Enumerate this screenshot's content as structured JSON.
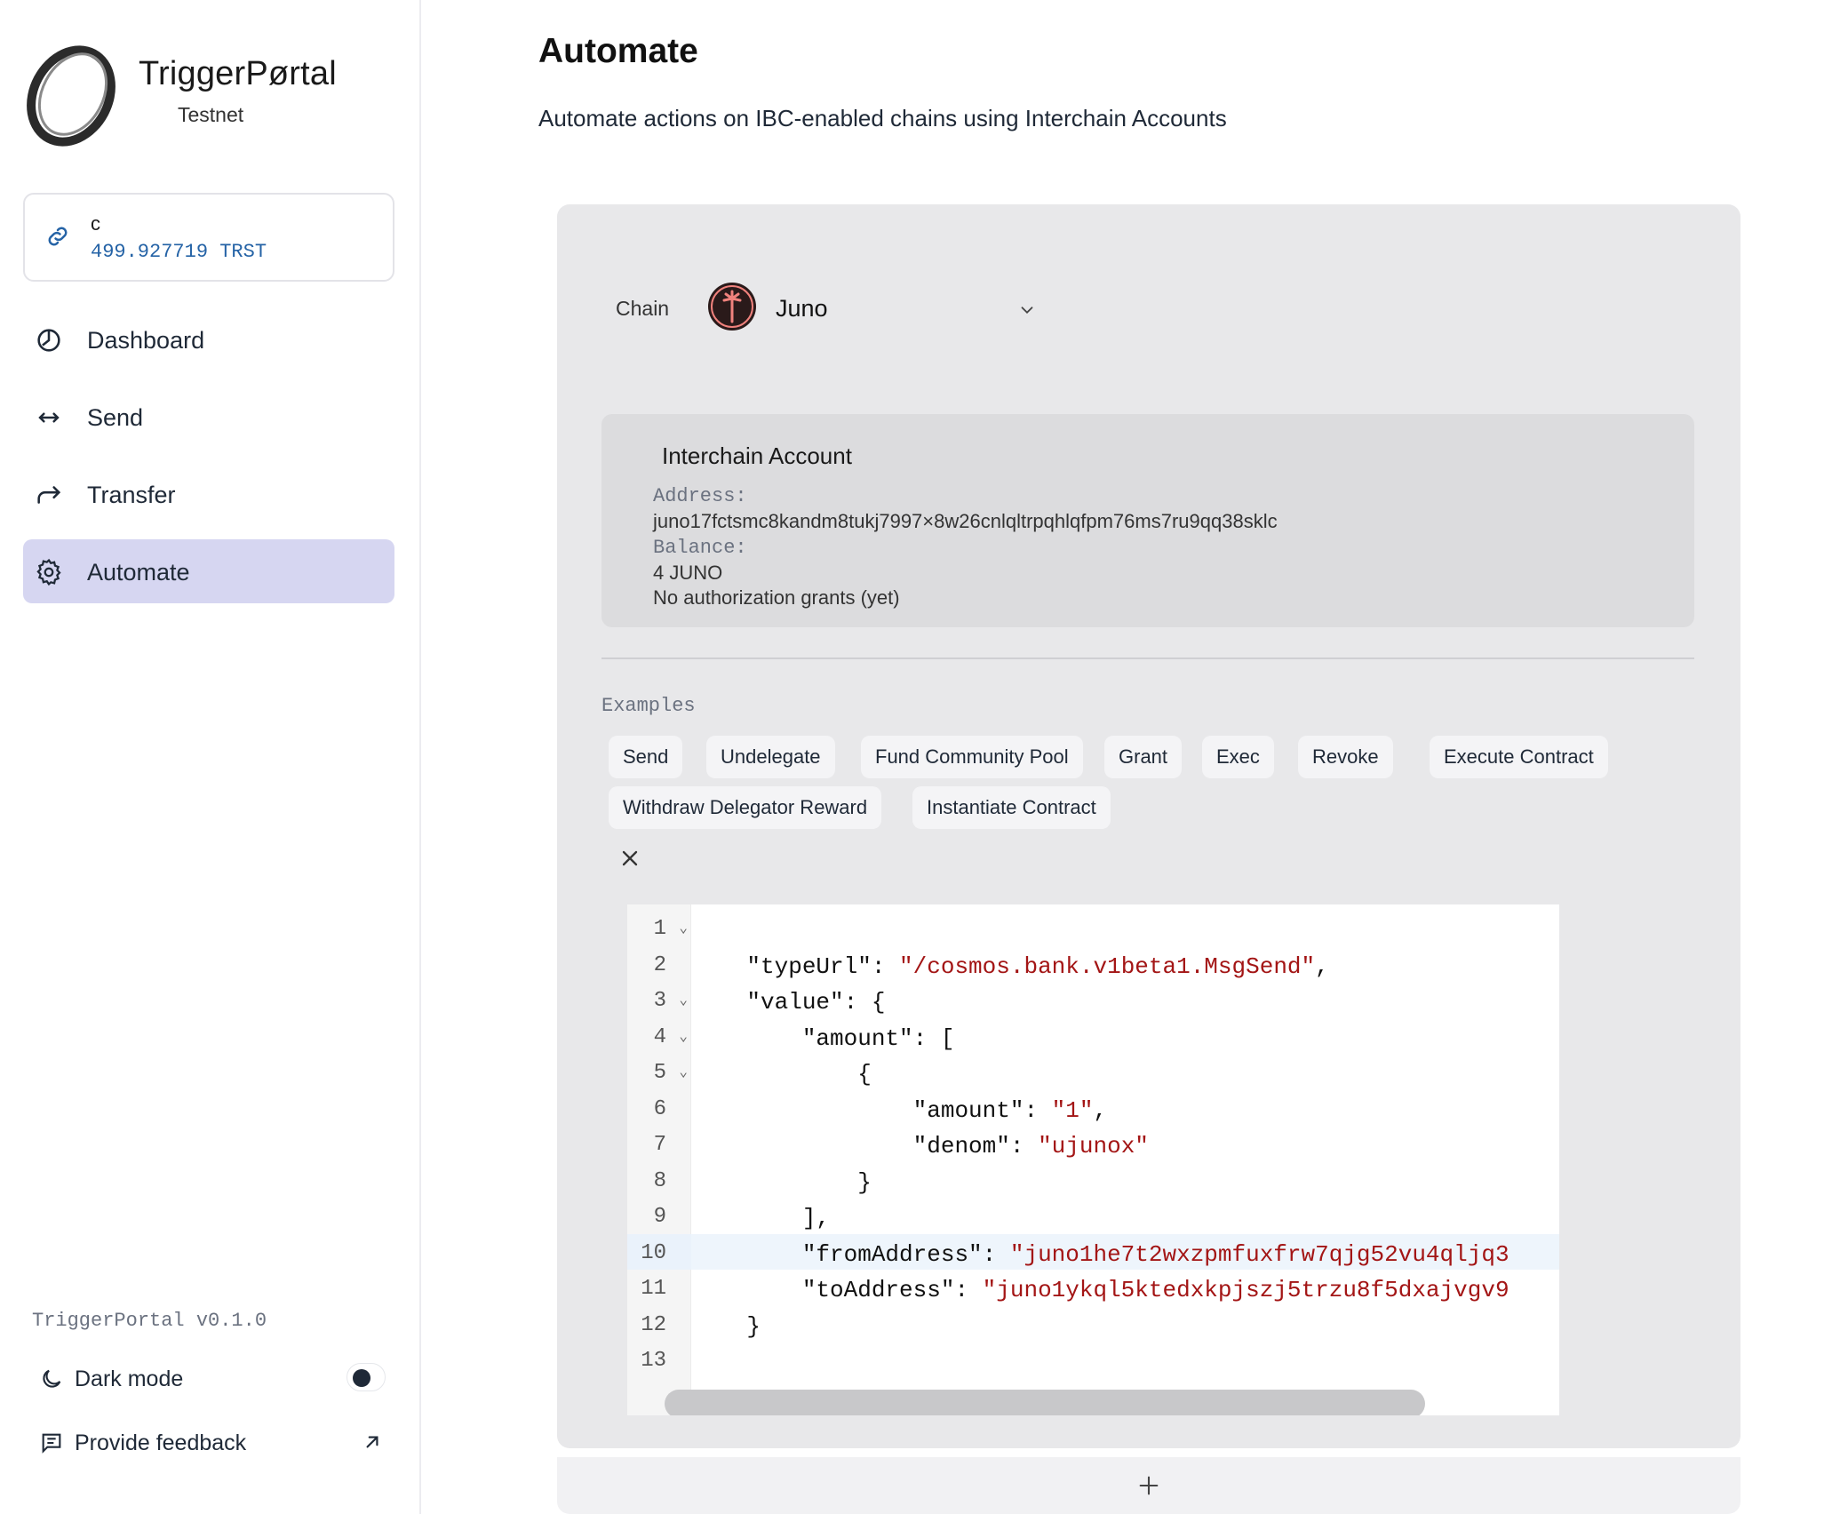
{
  "brand": {
    "name": "TriggerPørtal",
    "subtitle": "Testnet"
  },
  "wallet": {
    "name": "c",
    "balance": "499.927719 TRST",
    "icon": "link-icon"
  },
  "nav": [
    {
      "label": "Dashboard",
      "icon": "dashboard-icon",
      "active": false
    },
    {
      "label": "Send",
      "icon": "arrows-horizontal-icon",
      "active": false
    },
    {
      "label": "Transfer",
      "icon": "forward-arrow-icon",
      "active": false
    },
    {
      "label": "Automate",
      "icon": "gear-icon",
      "active": true
    }
  ],
  "footer": {
    "version": "TriggerPortal v0.1.0",
    "dark_mode_label": "Dark mode",
    "dark_mode_on": false,
    "feedback_label": "Provide feedback"
  },
  "page": {
    "title": "Automate",
    "description": "Automate actions on IBC-enabled chains using Interchain Accounts"
  },
  "chain": {
    "label": "Chain",
    "selected": "Juno",
    "logo_color": "#f0827d"
  },
  "interchain_account": {
    "title": "Interchain Account",
    "address_label": "Address:",
    "address": "juno17fctsmc8kandm8tukj7997×8w26cnlqltrpqhlqfpm76ms7ru9qq38sklc",
    "balance_label": "Balance:",
    "balance": "4 JUNO",
    "grants": "No authorization grants (yet)"
  },
  "examples": {
    "label": "Examples",
    "items": [
      "Send",
      "Undelegate",
      "Fund Community Pool",
      "Grant",
      "Exec",
      "Revoke",
      "Execute Contract",
      "Withdraw Delegator Reward",
      "Instantiate Contract"
    ]
  },
  "editor": {
    "active_line": 10,
    "lines": [
      {
        "n": "1",
        "fold": true,
        "parts": [
          [
            "",
            ""
          ]
        ]
      },
      {
        "n": "2",
        "fold": false,
        "parts": [
          [
            "    \"typeUrl\": ",
            ""
          ],
          [
            "\"/cosmos.bank.v1beta1.MsgSend\"",
            "str"
          ],
          [
            ",",
            ""
          ]
        ]
      },
      {
        "n": "3",
        "fold": true,
        "parts": [
          [
            "    \"value\": {",
            ""
          ]
        ]
      },
      {
        "n": "4",
        "fold": true,
        "parts": [
          [
            "        \"amount\": [",
            ""
          ]
        ]
      },
      {
        "n": "5",
        "fold": true,
        "parts": [
          [
            "            {",
            ""
          ]
        ]
      },
      {
        "n": "6",
        "fold": false,
        "parts": [
          [
            "                \"amount\": ",
            ""
          ],
          [
            "\"1\"",
            "str"
          ],
          [
            ",",
            ""
          ]
        ]
      },
      {
        "n": "7",
        "fold": false,
        "parts": [
          [
            "                \"denom\": ",
            ""
          ],
          [
            "\"ujunox\"",
            "str"
          ]
        ]
      },
      {
        "n": "8",
        "fold": false,
        "parts": [
          [
            "            }",
            ""
          ]
        ]
      },
      {
        "n": "9",
        "fold": false,
        "parts": [
          [
            "        ],",
            ""
          ]
        ]
      },
      {
        "n": "10",
        "fold": false,
        "parts": [
          [
            "        \"fromAddress\": ",
            ""
          ],
          [
            "\"juno1he7t2wxzpmfuxfrw7qjg52vu4qljq3",
            "str"
          ]
        ]
      },
      {
        "n": "11",
        "fold": false,
        "parts": [
          [
            "        \"toAddress\": ",
            ""
          ],
          [
            "\"juno1ykql5ktedxkpjszj5trzu8f5dxajvgv9",
            "str"
          ]
        ]
      },
      {
        "n": "12",
        "fold": false,
        "parts": [
          [
            "    }",
            ""
          ]
        ]
      },
      {
        "n": "13",
        "fold": false,
        "parts": [
          [
            "",
            ""
          ]
        ]
      }
    ]
  },
  "add_action_icon": "plus-icon"
}
